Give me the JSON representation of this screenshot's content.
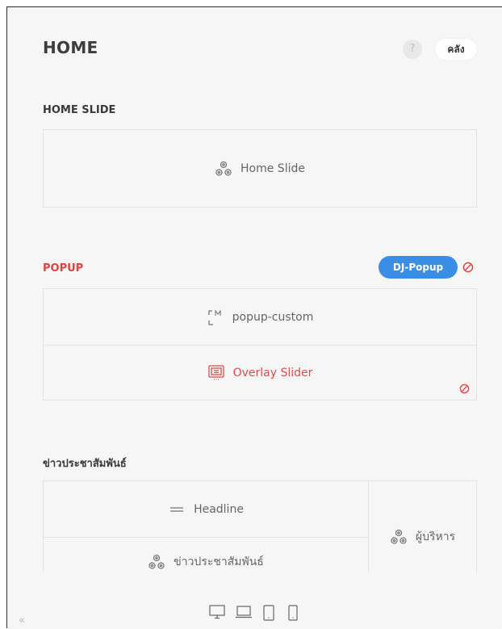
{
  "header": {
    "title": "HOME",
    "help_label": "?",
    "library_label": "คลัง"
  },
  "sections": [
    {
      "label": "HOME SLIDE",
      "items": [
        {
          "label": "Home Slide",
          "icon": "module-icon"
        }
      ]
    },
    {
      "label": "POPUP",
      "badge": "DJ-Popup",
      "items": [
        {
          "label": "popup-custom",
          "icon": "custom-module-icon"
        },
        {
          "label": "Overlay Slider",
          "icon": "slider-icon"
        }
      ]
    },
    {
      "label": "ข่าวประชาสัมพันธ์",
      "items": [
        {
          "label": "Headline",
          "icon": "headline-icon"
        },
        {
          "label": "ข่าวประชาสัมพันธ์",
          "icon": "module-icon"
        },
        {
          "label": "ผู้บริหาร",
          "icon": "module-icon"
        }
      ]
    }
  ],
  "footer": {
    "collapse_label": "«",
    "devices": [
      "desktop-icon",
      "laptop-icon",
      "tablet-icon",
      "mobile-icon"
    ]
  },
  "colors": {
    "accent_red": "#e04040",
    "badge_blue": "#3a8ee6",
    "border": "#e3e3e3"
  }
}
